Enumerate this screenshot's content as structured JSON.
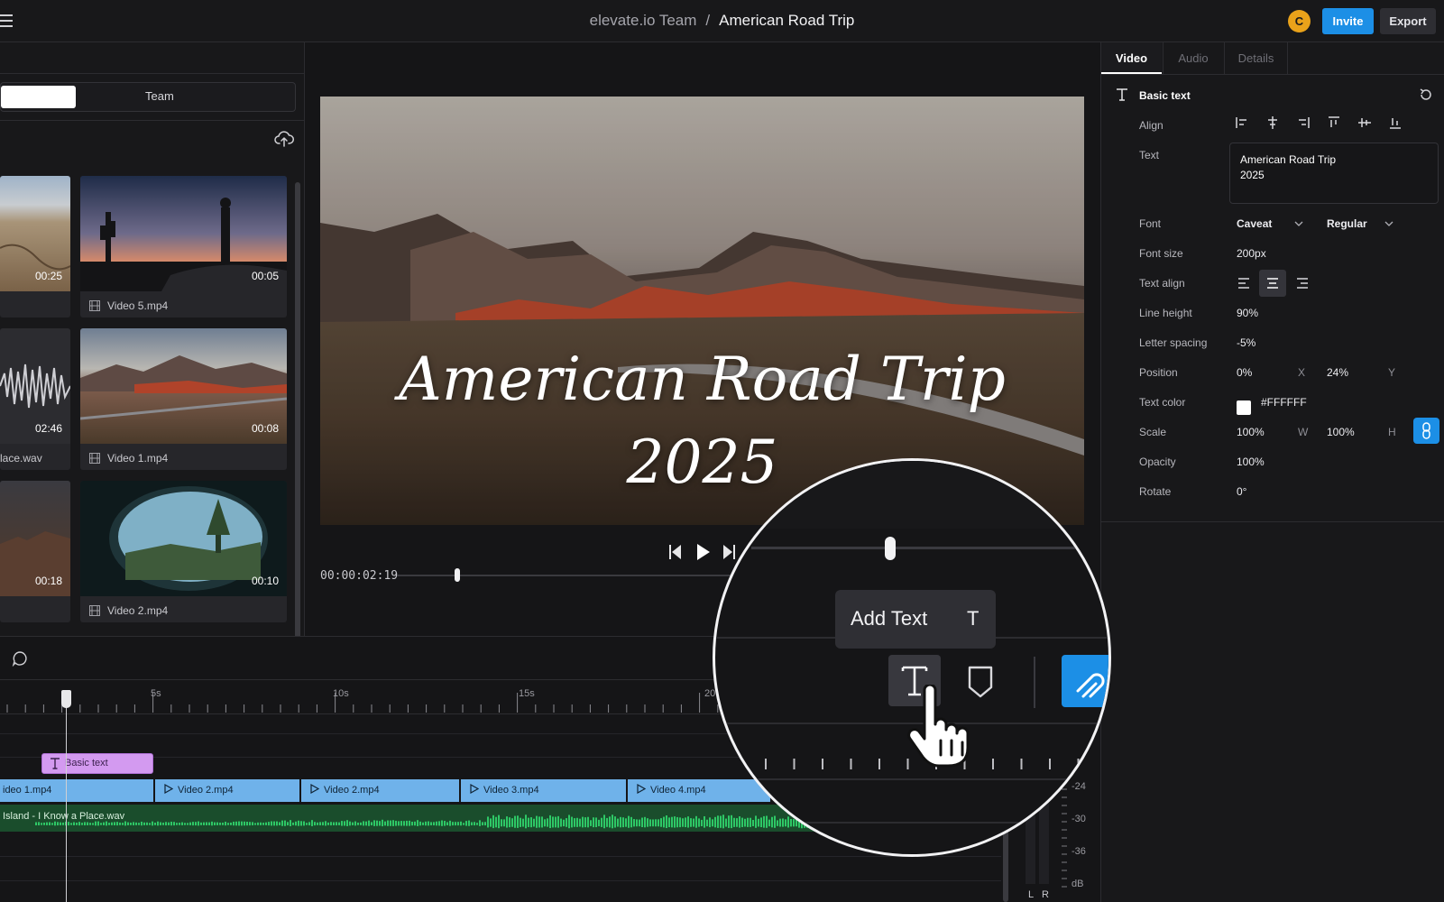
{
  "header": {
    "workspace": "elevate.io Team",
    "separator": "/",
    "project": "American Road Trip",
    "avatar_initial": "C",
    "invite_label": "Invite",
    "export_label": "Export"
  },
  "library": {
    "segments": [
      "",
      "Team"
    ],
    "items": [
      {
        "duration": "00:25",
        "name": ""
      },
      {
        "duration": "00:05",
        "name": "Video 5.mp4"
      },
      {
        "duration": "02:46",
        "name": "lace.wav"
      },
      {
        "duration": "00:08",
        "name": "Video 1.mp4"
      },
      {
        "duration": "00:18",
        "name": ""
      },
      {
        "duration": "00:10",
        "name": "Video 2.mp4"
      }
    ]
  },
  "preview": {
    "overlay_line1": "American Road Trip",
    "overlay_line2": "2025",
    "timecode": "00:00:02:19"
  },
  "panel": {
    "tabs": [
      "Video",
      "Audio",
      "Details"
    ],
    "section_title": "Basic text",
    "labels": {
      "align": "Align",
      "text": "Text",
      "font": "Font",
      "font_size": "Font size",
      "text_align": "Text align",
      "line_height": "Line height",
      "letter_spacing": "Letter spacing",
      "position": "Position",
      "text_color": "Text color",
      "scale": "Scale",
      "opacity": "Opacity",
      "rotate": "Rotate"
    },
    "values": {
      "text_line1": "American Road Trip",
      "text_line2": "2025",
      "font_family": "Caveat",
      "font_weight": "Regular",
      "font_size": "200px",
      "line_height": "90%",
      "letter_spacing": "-5%",
      "position_x": "0%",
      "position_x_unit": "X",
      "position_y": "24%",
      "position_y_unit": "Y",
      "text_color": "#FFFFFF",
      "scale_w": "100%",
      "scale_w_unit": "W",
      "scale_h": "100%",
      "scale_h_unit": "H",
      "opacity": "100%",
      "rotate": "0°"
    }
  },
  "timeline": {
    "ticks": [
      "5s",
      "10s",
      "15s",
      "20"
    ],
    "text_clip": "Basic text",
    "video_clips": [
      "ideo 1.mp4",
      "Video 2.mp4",
      "Video 2.mp4",
      "Video 3.mp4",
      "Video 4.mp4"
    ],
    "audio_clip": "Island - I Know a Place.wav",
    "db_labels": [
      "-24",
      "-30",
      "-36",
      "dB"
    ],
    "channels": [
      "L",
      "R"
    ]
  },
  "magnifier": {
    "tooltip_label": "Add Text",
    "tooltip_shortcut": "T"
  },
  "colors": {
    "accent": "#1C8FE6",
    "avatar": "#E9A21A",
    "text_clip": "#D39AF0",
    "video_clip": "#6FB2EA",
    "audio_clip": "#1A4D2C",
    "waveform": "#2EC866"
  }
}
